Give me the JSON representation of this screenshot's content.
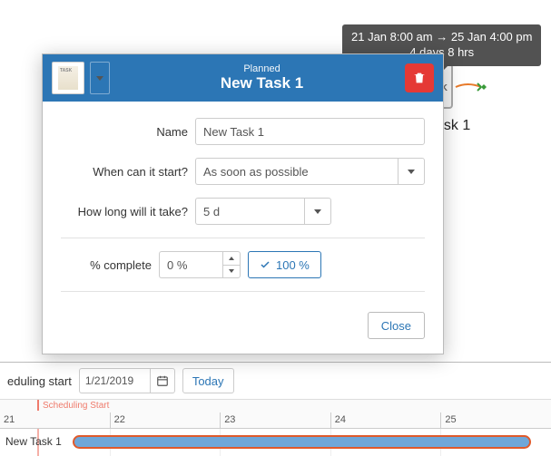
{
  "tooltip": {
    "line1": "21 Jan 8:00 am → 25 Jan 4:00 pm",
    "line2": "4 days 8 hrs"
  },
  "canvas": {
    "task_label": "ask 1",
    "card_letter": "K"
  },
  "dialog": {
    "kicker": "Planned",
    "title": "New Task 1",
    "fields": {
      "name_label": "Name",
      "name_value": "New Task 1",
      "start_label": "When can it start?",
      "start_value": "As soon as possible",
      "duration_label": "How long will it take?",
      "duration_value": "5 d",
      "complete_label": "% complete",
      "complete_value": "0 %",
      "btn_100": "100 %"
    },
    "close_label": "Close"
  },
  "timeline": {
    "toolbar": {
      "label": "eduling start",
      "date": "1/21/2019",
      "today": "Today"
    },
    "start_marker": "Scheduling Start",
    "days": [
      "21",
      "22",
      "23",
      "24",
      "25"
    ],
    "row_label": "New Task 1"
  }
}
